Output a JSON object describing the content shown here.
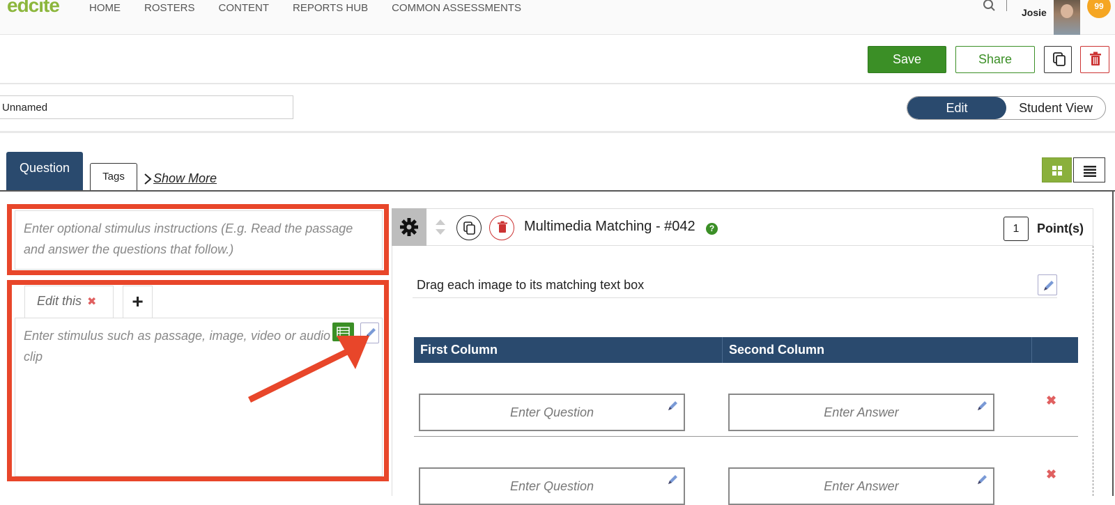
{
  "app": {
    "logo": "edcite",
    "nav": [
      "HOME",
      "ROSTERS",
      "CONTENT",
      "REPORTS HUB",
      "COMMON ASSESSMENTS"
    ],
    "user": {
      "name": "Josie",
      "notifications": "99"
    }
  },
  "toolbar": {
    "save_label": "Save",
    "share_label": "Share"
  },
  "assessment": {
    "name_value": "Unnamed"
  },
  "view_toggle": {
    "edit_label": "Edit",
    "student_label": "Student View",
    "active": "Edit"
  },
  "tabs": {
    "question": "Question",
    "tags": "Tags",
    "show_more": "Show More"
  },
  "stimulus": {
    "instructions_placeholder": "Enter optional stimulus instructions (E.g. Read the passage and answer the questions that follow.)",
    "tab_label": "Edit this",
    "add_tab": "+",
    "content_placeholder": "Enter stimulus such as passage, image, video or audio clip"
  },
  "question": {
    "title": "Multimedia Matching - #042",
    "help": "?",
    "points_value": "1",
    "points_label": "Point(s)",
    "instructions": "Drag each image to its matching text box",
    "columns": [
      "First Column",
      "Second Column"
    ],
    "rows": [
      {
        "question": "Enter Question",
        "answer": "Enter Answer"
      },
      {
        "question": "Enter Question",
        "answer": "Enter Answer"
      }
    ]
  },
  "colors": {
    "brand_green": "#3b8f26",
    "navy": "#2a4a6e",
    "annotation_red": "#e8462a",
    "badge_orange": "#f5a623"
  }
}
